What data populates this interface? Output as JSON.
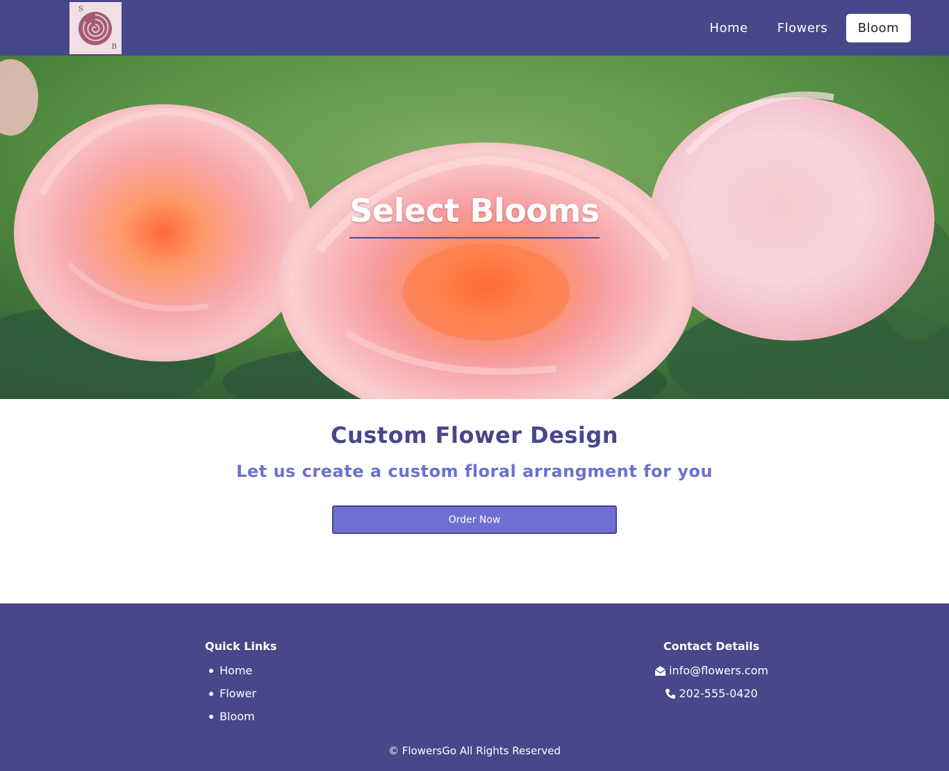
{
  "navbar": {
    "logo_letters": {
      "top_left": "S",
      "bottom_right": "B"
    },
    "links": [
      {
        "label": "Home"
      },
      {
        "label": "Flowers"
      },
      {
        "label": "Bloom",
        "active": true
      }
    ],
    "background_color": "#48478a"
  },
  "hero": {
    "title": "Select Blooms",
    "image": "pink-roses-photo",
    "underline_color": "#48478a"
  },
  "main": {
    "heading": "Custom Flower Design",
    "subheading": "Let us create a custom floral arrangment for you",
    "order_button_label": "Order Now",
    "heading_color": "#48478a",
    "accent_color": "#6f6fd1"
  },
  "footer": {
    "quick_links_title": "Quick Links",
    "quick_links": [
      "Home",
      "Flower",
      "Bloom"
    ],
    "contact_title": "Contact Details",
    "email": "info@flowers.com",
    "phone": "202-555-0420",
    "email_icon": "envelope-open-icon",
    "phone_icon": "phone-icon",
    "copyright": "© FlowersGo All Rights Reserved"
  }
}
